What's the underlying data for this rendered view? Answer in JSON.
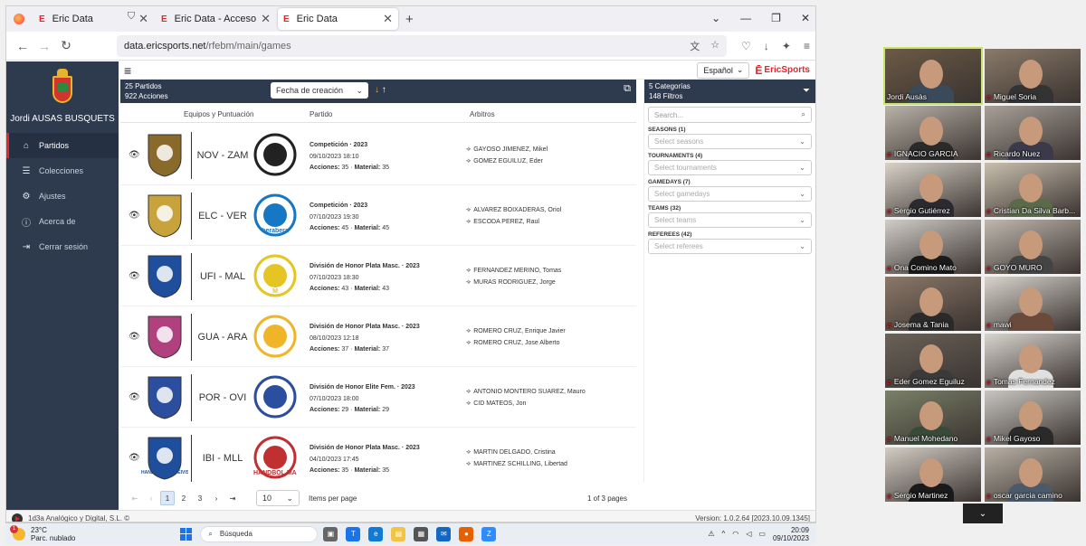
{
  "browser": {
    "tabs": [
      {
        "label": "Eric Data",
        "active": false
      },
      {
        "label": "Eric Data - Acceso",
        "active": false
      },
      {
        "label": "Eric Data",
        "active": true
      }
    ],
    "url_host": "data.ericsports.net",
    "url_path": "/rfebm/main/games"
  },
  "app": {
    "user_name": "Jordi AUSAS BUSQUETS",
    "menu": [
      {
        "label": "Partidos",
        "icon": "home-icon",
        "active": true
      },
      {
        "label": "Colecciones",
        "icon": "database-icon",
        "active": false
      },
      {
        "label": "Ajustes",
        "icon": "gear-icon",
        "active": false
      },
      {
        "label": "Acerca de",
        "icon": "info-icon",
        "active": false
      },
      {
        "label": "Cerrar sesión",
        "icon": "logout-icon",
        "active": false
      }
    ],
    "language": "Español",
    "brand": "EricSports",
    "list_header": {
      "matches_count": "25 Partidos",
      "actions_count": "922 Acciones",
      "sort_by": "Fecha de creación"
    },
    "columns": {
      "teams": "Equipos y Puntuación",
      "match": "Partido",
      "referees": "Arbitros"
    },
    "games": [
      {
        "code": "NOV - ZAM",
        "competition": "Competición · 2023",
        "datetime": "09/10/2023 18:10",
        "actions": "35",
        "material": "35",
        "referees": [
          "GAYOSO JIMENEZ, Mikel",
          "GOMEZ EGUILUZ, Eder"
        ],
        "home_color": "#8a6a2a",
        "away_color": "#222222"
      },
      {
        "code": "ELC - VER",
        "competition": "Competición · 2023",
        "datetime": "07/10/2023 19:30",
        "actions": "45",
        "material": "45",
        "referees": [
          "ALVAREZ BOIXADERAS, Oriol",
          "ESCODA PEREZ, Raul"
        ],
        "home_color": "#c8a23a",
        "away_color": "#1677c4",
        "away_text": "berabera"
      },
      {
        "code": "UFI - MAL",
        "competition": "División de Honor Plata Masc. · 2023",
        "datetime": "07/10/2023 18:30",
        "actions": "43",
        "material": "43",
        "referees": [
          "FERNANDEZ MERINO, Tomas",
          "MURAS RODRIGUEZ, Jorge"
        ],
        "home_color": "#1f4f9c",
        "away_color": "#e4c524",
        "away_text": "M"
      },
      {
        "code": "GUA - ARA",
        "competition": "División de Honor Plata Masc. · 2023",
        "datetime": "08/10/2023 12:18",
        "actions": "37",
        "material": "37",
        "referees": [
          "ROMERO CRUZ, Enrique Javier",
          "ROMERO CRUZ, Jose Alberto"
        ],
        "home_color": "#b0417e",
        "away_color": "#f0b429"
      },
      {
        "code": "POR - OVI",
        "competition": "División de Honor Elite Fem. · 2023",
        "datetime": "07/10/2023 18:00",
        "actions": "29",
        "material": "29",
        "referees": [
          "ANTONIO MONTERO SUAREZ, Mauro",
          "CID MATEOS, Jon"
        ],
        "home_color": "#2c4e9e",
        "away_color": "#2c4e9e"
      },
      {
        "code": "IBI - MLL",
        "competition": "División de Honor Plata Masc. · 2023",
        "datetime": "04/10/2023 17:45",
        "actions": "35",
        "material": "35",
        "referees": [
          "MARTIN DELGADO, Cristina",
          "MARTINEZ SCHILLING, Libertad"
        ],
        "home_color": "#1f4f9c",
        "away_color": "#c03030",
        "home_text": "HANDBOLCLUB EIVISSA",
        "away_text": "HANDBOL MALLORCA"
      }
    ],
    "labels": {
      "actions": "Acciones",
      "material": "Material"
    },
    "pagination": {
      "pages": [
        "1",
        "2",
        "3"
      ],
      "current": "1",
      "per_page": "10",
      "per_page_label": "Items per page",
      "page_of": "1 of 3 pages"
    },
    "filters": {
      "categories": "5 Categorías",
      "filters_count": "148 Filtros",
      "search_placeholder": "Search...",
      "groups": [
        {
          "label": "SEASONS (1)",
          "placeholder": "Select seasons"
        },
        {
          "label": "TOURNAMENTS (4)",
          "placeholder": "Select tournaments"
        },
        {
          "label": "GAMEDAYS (7)",
          "placeholder": "Select gamedays"
        },
        {
          "label": "TEAMS (32)",
          "placeholder": "Select teams"
        },
        {
          "label": "REFEREES (42)",
          "placeholder": "Select referees"
        }
      ]
    },
    "footer": {
      "company": "1d3a Analógico y Digital, S.L. ©",
      "version": "Version: 1.0.2.64 [2023.10.09.1345]"
    }
  },
  "taskbar": {
    "temperature": "23°C",
    "weather": "Parc. nublado",
    "search": "Búsqueda",
    "time": "20:09",
    "date": "09/10/2023"
  },
  "participants": [
    {
      "name": "Jordi Ausàs",
      "muted": false,
      "active": true,
      "bg": "#6b5a46",
      "shirt": "#3a4a5a"
    },
    {
      "name": "Miguel Soria",
      "muted": true,
      "bg": "#8a7a6a",
      "shirt": "#333333"
    },
    {
      "name": "IGNACIO GARCIA",
      "muted": true,
      "bg": "#b8b2a8",
      "shirt": "#2a2a2a"
    },
    {
      "name": "Ricardo Nuez",
      "muted": true,
      "bg": "#a8a098",
      "shirt": "#3a3a4a"
    },
    {
      "name": "Sergio Gutiérrez",
      "muted": true,
      "bg": "#d8d2c8",
      "shirt": "#2a2a30"
    },
    {
      "name": "Cristian Da Silva Barb...",
      "muted": true,
      "bg": "#c8bfae",
      "shirt": "#5a6a4a"
    },
    {
      "name": "Ona Comino Mato",
      "muted": true,
      "bg": "#d0ccc6",
      "shirt": "#1a1a1a"
    },
    {
      "name": "GOYO MURO",
      "muted": true,
      "bg": "#c0b8ae",
      "shirt": "#444444"
    },
    {
      "name": "Josema & Tania",
      "muted": true,
      "bg": "#8a7868",
      "shirt": "#2a2a2a"
    },
    {
      "name": "mawi",
      "muted": true,
      "bg": "#d8d4cc",
      "shirt": "#6a4a3a"
    },
    {
      "name": "Eder Gomez Eguiluz",
      "muted": true,
      "bg": "#6a6258",
      "shirt": "#3a3a3a"
    },
    {
      "name": "Tomas Fernandez",
      "muted": true,
      "bg": "#d8d4ce",
      "shirt": "#e0e0e0"
    },
    {
      "name": "Manuel Mohedano",
      "muted": true,
      "bg": "#7a8068",
      "shirt": "#3a4a3a"
    },
    {
      "name": "Mikel Gayoso",
      "muted": true,
      "bg": "#c8c6c0",
      "shirt": "#2a2a2a"
    },
    {
      "name": "Sergio Martinez",
      "muted": true,
      "bg": "#d2ccc4",
      "shirt": "#1a1a1a"
    },
    {
      "name": "oscar garcia camino",
      "muted": true,
      "bg": "#b8b0a4",
      "shirt": "#4a5a6a"
    }
  ]
}
